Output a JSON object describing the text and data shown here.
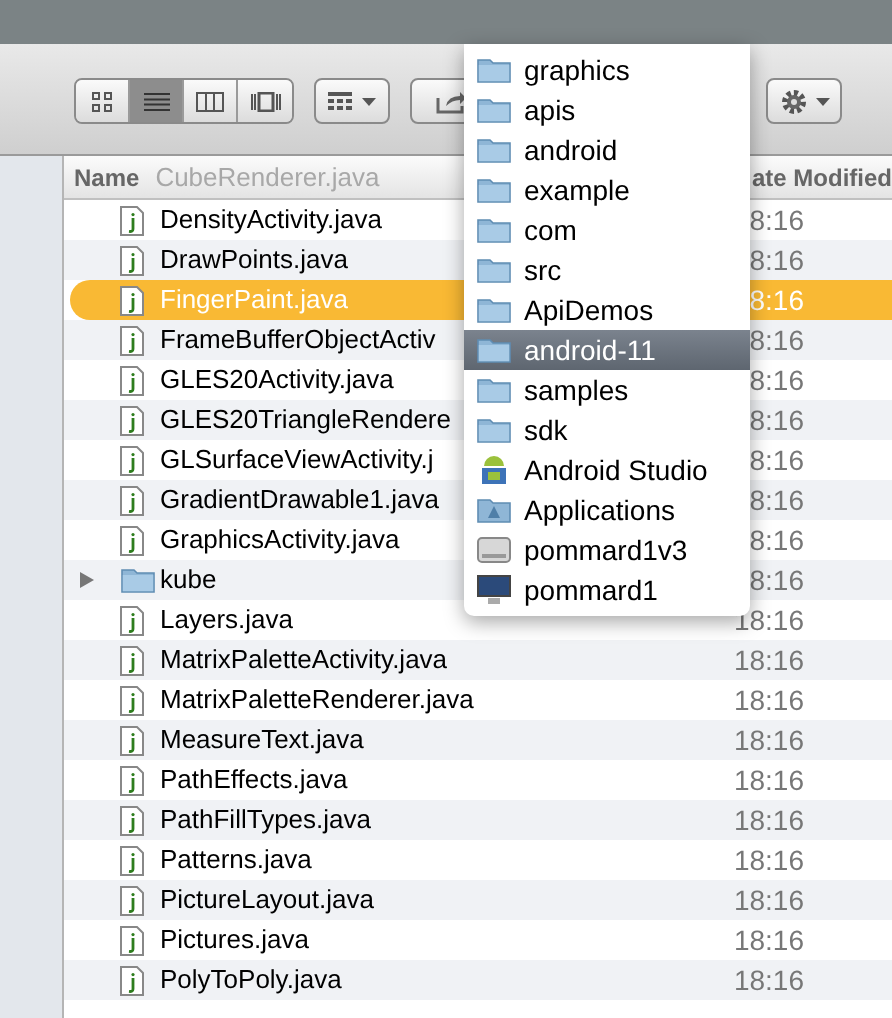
{
  "toolbar": {
    "view_modes": [
      {
        "kind": "icons",
        "selected": false
      },
      {
        "kind": "list",
        "selected": true
      },
      {
        "kind": "columns",
        "selected": false
      },
      {
        "kind": "coverflow",
        "selected": false
      }
    ]
  },
  "header": {
    "name": "Name",
    "ghost": "CubeRenderer.java",
    "date": "ate Modified"
  },
  "files": [
    {
      "name": "DensityActivity.java",
      "time": "8:16",
      "kind": "file",
      "selected": false
    },
    {
      "name": "DrawPoints.java",
      "time": "8:16",
      "kind": "file",
      "selected": false
    },
    {
      "name": "FingerPaint.java",
      "time": "8:16",
      "kind": "file",
      "selected": true
    },
    {
      "name": "FrameBufferObjectActiv",
      "time": "8:16",
      "kind": "file",
      "selected": false
    },
    {
      "name": "GLES20Activity.java",
      "time": "8:16",
      "kind": "file",
      "selected": false
    },
    {
      "name": "GLES20TriangleRendere",
      "time": "8:16",
      "kind": "file",
      "selected": false
    },
    {
      "name": "GLSurfaceViewActivity.j",
      "time": "8:16",
      "kind": "file",
      "selected": false
    },
    {
      "name": "GradientDrawable1.java",
      "time": "8:16",
      "kind": "file",
      "selected": false
    },
    {
      "name": "GraphicsActivity.java",
      "time": "8:16",
      "kind": "file",
      "selected": false
    },
    {
      "name": "kube",
      "time": "8:16",
      "kind": "folder",
      "selected": false
    },
    {
      "name": "Layers.java",
      "time": "18:16",
      "kind": "file",
      "selected": false
    },
    {
      "name": "MatrixPaletteActivity.java",
      "time": "18:16",
      "kind": "file",
      "selected": false
    },
    {
      "name": "MatrixPaletteRenderer.java",
      "time": "18:16",
      "kind": "file",
      "selected": false
    },
    {
      "name": "MeasureText.java",
      "time": "18:16",
      "kind": "file",
      "selected": false
    },
    {
      "name": "PathEffects.java",
      "time": "18:16",
      "kind": "file",
      "selected": false
    },
    {
      "name": "PathFillTypes.java",
      "time": "18:16",
      "kind": "file",
      "selected": false
    },
    {
      "name": "Patterns.java",
      "time": "18:16",
      "kind": "file",
      "selected": false
    },
    {
      "name": "PictureLayout.java",
      "time": "18:16",
      "kind": "file",
      "selected": false
    },
    {
      "name": "Pictures.java",
      "time": "18:16",
      "kind": "file",
      "selected": false
    },
    {
      "name": "PolyToPoly.java",
      "time": "18:16",
      "kind": "file",
      "selected": false
    }
  ],
  "path_menu": [
    {
      "label": "graphics",
      "kind": "folder",
      "selected": false
    },
    {
      "label": "apis",
      "kind": "folder",
      "selected": false
    },
    {
      "label": "android",
      "kind": "folder",
      "selected": false
    },
    {
      "label": "example",
      "kind": "folder",
      "selected": false
    },
    {
      "label": "com",
      "kind": "folder",
      "selected": false
    },
    {
      "label": "src",
      "kind": "folder",
      "selected": false
    },
    {
      "label": "ApiDemos",
      "kind": "folder",
      "selected": false
    },
    {
      "label": "android-11",
      "kind": "folder",
      "selected": true
    },
    {
      "label": "samples",
      "kind": "folder",
      "selected": false
    },
    {
      "label": "sdk",
      "kind": "folder",
      "selected": false
    },
    {
      "label": "Android Studio",
      "kind": "app",
      "selected": false
    },
    {
      "label": "Applications",
      "kind": "apps",
      "selected": false
    },
    {
      "label": "pommard1v3",
      "kind": "disk",
      "selected": false
    },
    {
      "label": "pommard1",
      "kind": "computer",
      "selected": false
    }
  ]
}
